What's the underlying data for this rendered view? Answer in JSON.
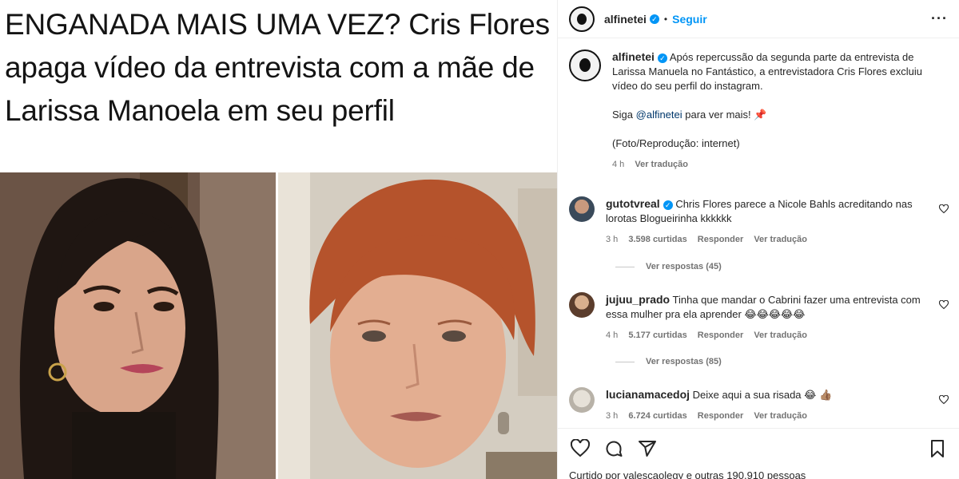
{
  "post": {
    "headline": "ENGANADA MAIS UMA VEZ? Cris Flores apaga vídeo da entrevista com a mãe de Larissa Manoela em seu perfil"
  },
  "header": {
    "username": "alfinetei",
    "separator": "•",
    "follow_label": "Seguir",
    "more_label": "···"
  },
  "caption": {
    "username": "alfinetei",
    "text": "Após repercussão da segunda parte da entrevista de Larissa Manuela no Fantástico, a entrevistadora Cris Flores excluiu vídeo do seu perfil do instagram.",
    "follow_prefix": "Siga ",
    "follow_mention": "@alfinetei",
    "follow_suffix": " para ver mais! 📌",
    "credit": "(Foto/Reprodução: internet)",
    "time": "4 h",
    "translate": "Ver tradução"
  },
  "comments": [
    {
      "username": "gutotvreal",
      "text": "Chris Flores parece a Nicole Bahls acreditando nas lorotas Blogueirinha kkkkkk",
      "time": "3 h",
      "likes": "3.598 curtidas",
      "reply": "Responder",
      "translate": "Ver tradução",
      "replies": "Ver respostas (45)"
    },
    {
      "username": "jujuu_prado",
      "text": "Tinha que mandar o Cabrini fazer uma entrevista com essa mulher pra ela aprender 😂😂😂😂😂",
      "time": "4 h",
      "likes": "5.177 curtidas",
      "reply": "Responder",
      "translate": "Ver tradução",
      "replies": "Ver respostas (85)"
    },
    {
      "username": "lucianamacedoj",
      "text": "Deixe aqui a sua risada 😂 👍🏽",
      "time": "3 h",
      "likes": "6.724 curtidas",
      "reply": "Responder",
      "translate": "Ver tradução"
    }
  ],
  "footer": {
    "likes_text": "Curtido por valescaolegy e outras 190.910 pessoas"
  },
  "icons": {
    "like": "heart-icon",
    "comment": "comment-icon",
    "share": "share-icon",
    "save": "bookmark-icon"
  },
  "colors": {
    "link_blue": "#0095f6",
    "mention": "#00376b",
    "secondary_text": "#737373"
  }
}
